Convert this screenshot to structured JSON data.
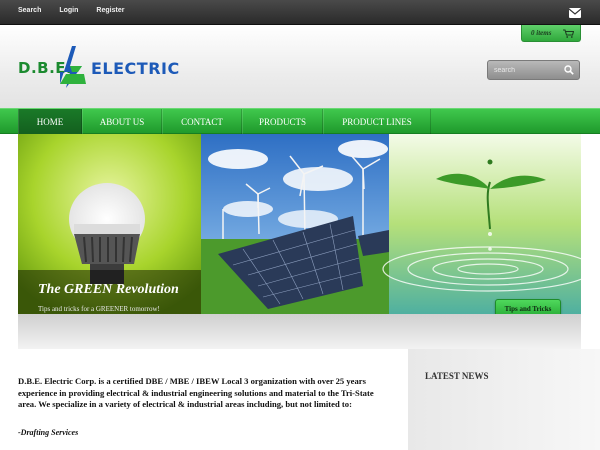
{
  "topbar": {
    "links": [
      "Search",
      "Login",
      "Register"
    ],
    "mail_icon": "envelope-icon"
  },
  "cart": {
    "label": "0 items",
    "icon": "shopping-cart-icon"
  },
  "logo": {
    "part1": "D.B.E.",
    "part2": "ELECTRIC",
    "mark_icon": "lightning-bolt-logo"
  },
  "search": {
    "placeholder": "search",
    "icon": "search-icon"
  },
  "nav": {
    "items": [
      "HOME",
      "ABOUT US",
      "CONTACT",
      "PRODUCTS",
      "PRODUCT LINES"
    ],
    "active": "HOME"
  },
  "hero": {
    "title": "The GREEN Revolution",
    "subtitle": "Tips and tricks for a GREENER tomorrow!",
    "button": "Tips and Tricks"
  },
  "intro": {
    "text": "D.B.E. Electric Corp. is a certified DBE / MBE / IBEW Local 3 organization with over 25 years experience in providing electrical & industrial engineering solutions and material to the Tri-State area. We specialize in a variety of electrical & industrial areas including, but not limited to:",
    "first_item": "-Drafting Services"
  },
  "news": {
    "title": "LATEST NEWS"
  },
  "colors": {
    "brand_green": "#2fb23d",
    "brand_blue": "#1d5ab8",
    "topbar": "#333333"
  }
}
